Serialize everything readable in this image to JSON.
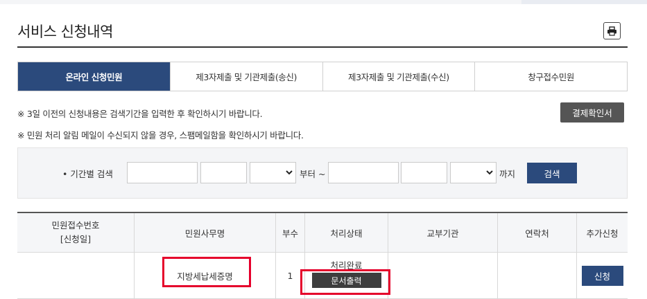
{
  "page": {
    "title": "서비스 신청내역"
  },
  "tabs": [
    {
      "label": "온라인 신청민원",
      "active": true
    },
    {
      "label": "제3자제출 및 기관제출(송신)",
      "active": false
    },
    {
      "label": "제3자제출 및 기관제출(수신)",
      "active": false
    },
    {
      "label": "창구접수민원",
      "active": false
    }
  ],
  "notices": [
    "※ 3일 이전의 신청내용은 검색기간을 입력한 후 확인하시기 바랍니다.",
    "※ 민원 처리 알림 메일이 수신되지 않을 경우, 스팸메일함을 확인하시기 바랍니다."
  ],
  "buttons": {
    "receipt": "결제확인서",
    "search": "검색",
    "print_icon": "printer-icon"
  },
  "search": {
    "label": "• 기간별 검색",
    "from_suffix": "부터 ~",
    "to_suffix": "까지",
    "start_year": "",
    "start_month": "",
    "start_day": "",
    "end_year": "",
    "end_month": "",
    "end_day": ""
  },
  "table": {
    "headers": {
      "receipt_no": "민원접수번호",
      "apply_date": "[신청일]",
      "service_name": "민원사무명",
      "copies": "부수",
      "status": "처리상태",
      "issuing_agency": "교부기관",
      "contact": "연락처",
      "extra_apply": "추가신청"
    },
    "rows": [
      {
        "receipt_no": "",
        "service_name": "지방세납세증명",
        "copies": "1",
        "status": "처리완료",
        "doc_button": "문서출력",
        "issuing_agency": "",
        "contact": "",
        "apply_button": "신청"
      }
    ]
  },
  "colors": {
    "accent": "#2b4a7c",
    "highlight": "#e5002b",
    "dark_button": "#3e3e3e"
  }
}
